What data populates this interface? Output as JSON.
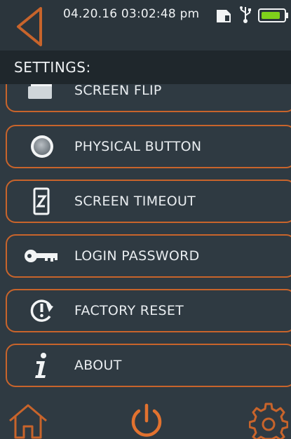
{
  "status": {
    "datetime": "04.20.16  03:02:48 pm",
    "colors": {
      "accent": "#c8642b",
      "battery_fill": "#7fd11b"
    }
  },
  "header": {
    "title": "SETTINGS:"
  },
  "menu": {
    "items": [
      {
        "label": "SCREEN FLIP",
        "icon": "screen-flip-icon"
      },
      {
        "label": "PHYSICAL BUTTON",
        "icon": "physical-button-icon"
      },
      {
        "label": "SCREEN TIMEOUT",
        "icon": "screen-timeout-icon"
      },
      {
        "label": "LOGIN PASSWORD",
        "icon": "key-icon"
      },
      {
        "label": "FACTORY RESET",
        "icon": "factory-reset-icon"
      },
      {
        "label": "ABOUT",
        "icon": "info-icon"
      }
    ]
  },
  "nav": {
    "home": "home-icon",
    "power": "power-icon",
    "settings": "gear-icon"
  }
}
